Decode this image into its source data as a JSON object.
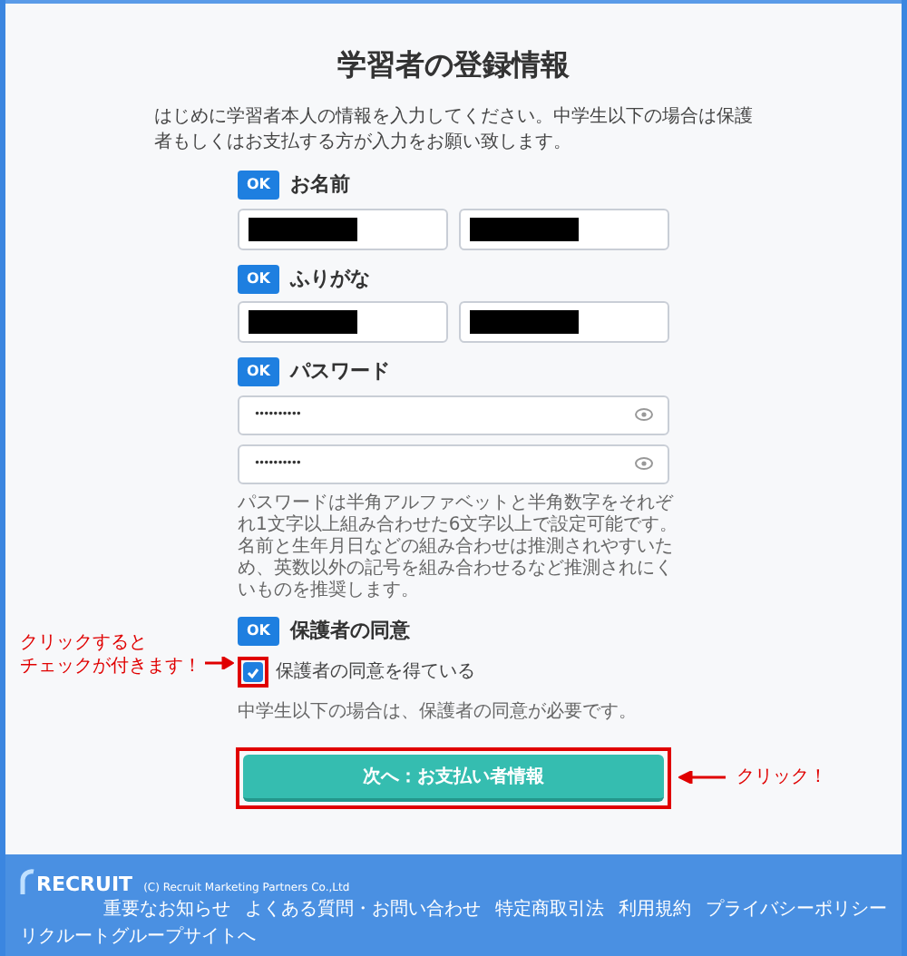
{
  "title": "学習者の登録情報",
  "intro": "はじめに学習者本人の情報を入力してください。中学生以下の場合は保護者もしくはお支払する方が入力をお願い致します。",
  "sections": [
    {
      "kind": "name_pair",
      "badge": "OK",
      "label": "お名前"
    },
    {
      "kind": "name_pair",
      "badge": "OK",
      "label": "ふりがな"
    },
    {
      "kind": "password",
      "badge": "OK",
      "label": "パスワード",
      "fields": [
        "••••••••••",
        "••••••••••"
      ],
      "hint": "パスワードは半角アルファベットと半角数字をそれぞれ1文字以上組み合わせた6文字以上で設定可能です。名前と生年月日などの組み合わせは推測されやすいため、英数以外の記号を組み合わせるなど推測されにくいものを推奨します。"
    },
    {
      "kind": "consent",
      "badge": "OK",
      "label": "保護者の同意",
      "checkbox": {
        "label": "保護者の同意を得ている",
        "checked": true
      },
      "note": "中学生以下の場合は、保護者の同意が必要です。"
    }
  ],
  "submit": "次へ：お支払い者情報",
  "annotations": [
    {
      "kind": "checkbox_callout",
      "lines": [
        "クリックすると",
        "チェックが付きます！"
      ]
    },
    {
      "kind": "button_callout",
      "lines": [
        "クリック！"
      ]
    }
  ],
  "footer": {
    "logo": "RECRUIT",
    "copyright": "(C) Recruit Marketing Partners Co.,Ltd",
    "links": [
      "重要なお知らせ",
      "よくある質問・お問い合わせ",
      "特定商取引法",
      "利用規約",
      "プライバシーポリシー"
    ],
    "group_link": "リクルートグループサイトへ"
  }
}
